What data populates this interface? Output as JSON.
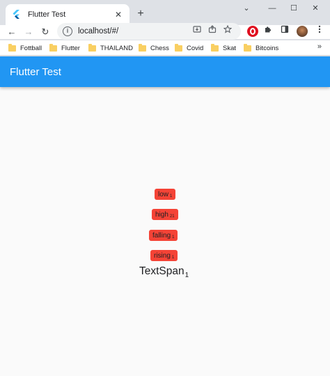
{
  "browser": {
    "tab": {
      "title": "Flutter Test",
      "close_glyph": "✕"
    },
    "new_tab_glyph": "+",
    "window_controls": {
      "dropdown": "⌄",
      "minimize": "—",
      "maximize": "☐",
      "close": "✕"
    },
    "nav": {
      "back": "←",
      "forward": "→",
      "reload": "↻"
    },
    "address": {
      "url": "localhost/#/",
      "info_glyph": "i"
    },
    "bookmarks": [
      {
        "label": "Fottball"
      },
      {
        "label": "Flutter"
      },
      {
        "label": "THAILAND"
      },
      {
        "label": "Chess"
      },
      {
        "label": "Covid"
      },
      {
        "label": "Skat"
      },
      {
        "label": "Bitcoins"
      }
    ],
    "bookmarks_more": "»"
  },
  "app": {
    "title": "Flutter Test",
    "chips": [
      {
        "text": "low",
        "sub": "1"
      },
      {
        "text": "high",
        "sub": "21"
      },
      {
        "text": "falling",
        "sub": "1"
      },
      {
        "text": "rising",
        "sub": "1"
      }
    ],
    "textspan": {
      "text": "TextSpan",
      "sub": "1"
    }
  },
  "colors": {
    "appbar": "#2196f3",
    "chip": "#f44336",
    "page_bg": "#fafafa"
  }
}
